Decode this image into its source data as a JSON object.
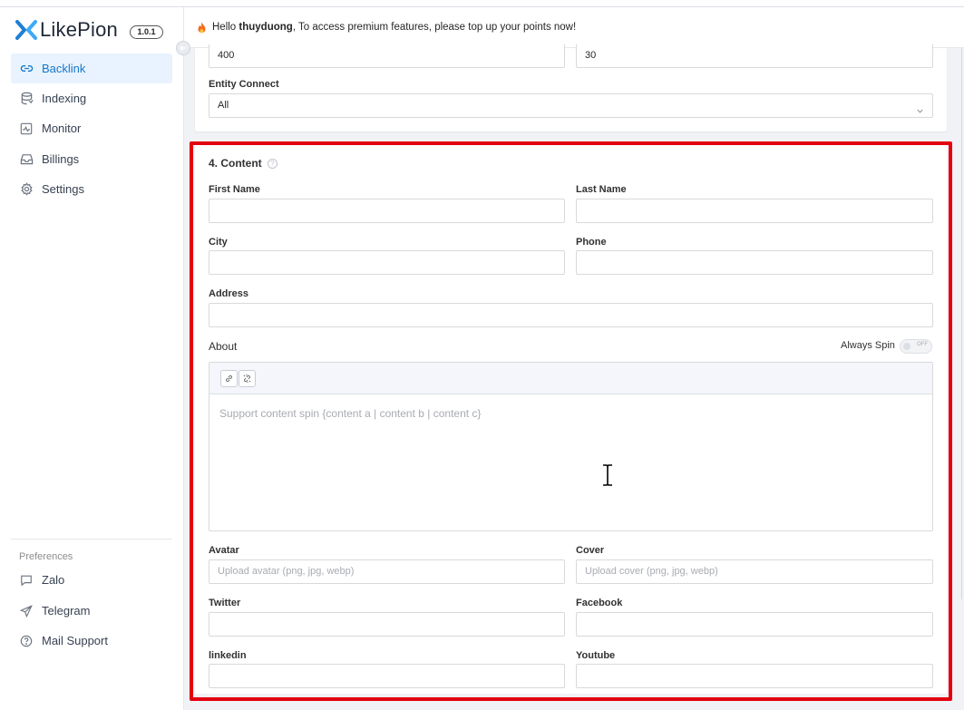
{
  "brand": {
    "name": "LikePion",
    "version": "1.0.1"
  },
  "sidebar": {
    "items": [
      {
        "label": "Backlink",
        "icon": "link-icon",
        "active": true
      },
      {
        "label": "Indexing",
        "icon": "database-icon",
        "active": false
      },
      {
        "label": "Monitor",
        "icon": "pulse-icon",
        "active": false
      },
      {
        "label": "Billings",
        "icon": "inbox-icon",
        "active": false
      },
      {
        "label": "Settings",
        "icon": "gear-icon",
        "active": false
      }
    ],
    "preferences_title": "Preferences",
    "preferences": [
      {
        "label": "Zalo",
        "icon": "chat-icon"
      },
      {
        "label": "Telegram",
        "icon": "send-icon"
      },
      {
        "label": "Mail Support",
        "icon": "help-icon"
      }
    ]
  },
  "header": {
    "greeting_prefix": "Hello ",
    "username": "thuyduong",
    "message": ", To access premium features, please top up your points now!"
  },
  "top_panel": {
    "field_left_value": "400",
    "field_right_value": "30",
    "entity_connect_label": "Entity Connect",
    "entity_connect_value": "All"
  },
  "content": {
    "title": "4. Content",
    "first_name_label": "First Name",
    "last_name_label": "Last Name",
    "city_label": "City",
    "phone_label": "Phone",
    "address_label": "Address",
    "about_label": "About",
    "always_spin_label": "Always Spin",
    "toggle_text": "OFF",
    "about_placeholder": "Support content spin {content a | content b | content c}",
    "avatar_label": "Avatar",
    "avatar_placeholder": "Upload avatar (png, jpg, webp)",
    "cover_label": "Cover",
    "cover_placeholder": "Upload cover (png, jpg, webp)",
    "twitter_label": "Twitter",
    "facebook_label": "Facebook",
    "linkedin_label": "linkedin",
    "youtube_label": "Youtube"
  },
  "colors": {
    "accent": "#1677c9",
    "active_bg": "#e8f3ff",
    "highlight": "#e3000f"
  }
}
